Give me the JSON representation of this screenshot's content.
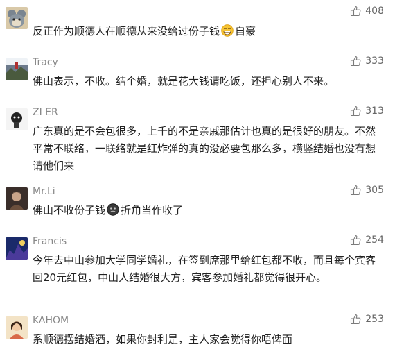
{
  "comments": [
    {
      "name": "",
      "likes": "408",
      "text_before": "反正作为顺德人在顺德从来没给过份子钱",
      "emoji": "grinning-emoji",
      "text_after": "自豪"
    },
    {
      "name": "Tracy",
      "likes": "333",
      "text": "佛山表示，不收。结个婚，就是花大钱请吃饭，还担心别人不来。"
    },
    {
      "name": "ZI ER",
      "likes": "313",
      "text": "广东真的是不会包很多，上千的不是亲戚那估计也真的是很好的朋友。不然平常不联络，一联络就是红炸弹的真的没必要包那么多，横竖结婚也没有想请他们来"
    },
    {
      "name": "Mr.Li",
      "likes": "305",
      "text_before": "佛山不收份子钱",
      "emoji": "dark-face-emoji",
      "text_after": "折角当作收了"
    },
    {
      "name": "Francis",
      "likes": "254",
      "text": "今年去中山参加大学同学婚礼，在签到席那里给红包都不收，而且每个宾客回20元红包，中山人结婚很大方，宾客参加婚礼都觉得很开心。"
    },
    {
      "name": "KAHOM",
      "likes": "253",
      "text": "系顺德摆结婚酒，如果你封利是，主人家会觉得你唔俾面"
    }
  ],
  "icons": {
    "like": "thumbs-up-icon"
  },
  "colors": {
    "name": "#888888",
    "text": "#222222",
    "like": "#666666"
  }
}
